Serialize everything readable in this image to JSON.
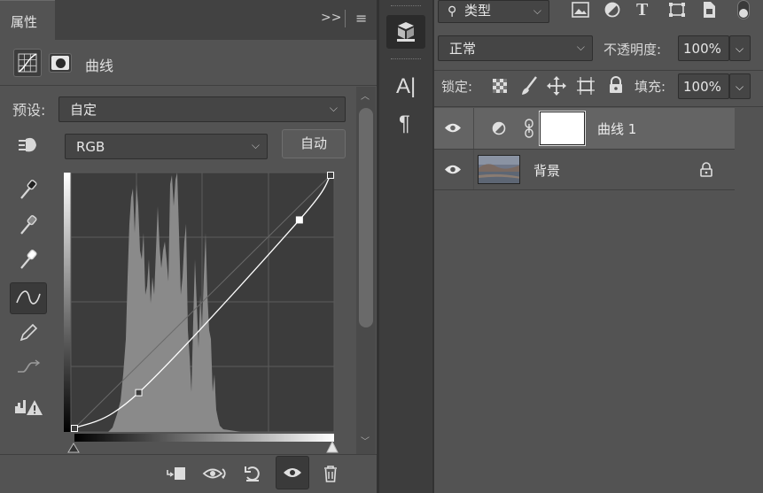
{
  "properties": {
    "tab_title": "属性",
    "header_collapse": ">>",
    "panel_title": "曲线",
    "preset_label": "预设:",
    "preset_value": "自定",
    "channel_value": "RGB",
    "auto_button": "自动"
  },
  "curve": {
    "points": [
      [
        0,
        0
      ],
      [
        64,
        36
      ],
      [
        224,
        210
      ],
      [
        255,
        255
      ]
    ]
  },
  "toolbar_mid": {
    "character_label": "A|",
    "paragraph_label": "¶"
  },
  "layers_panel": {
    "filter_type": "类型",
    "blend_mode": "正常",
    "opacity_label": "不透明度:",
    "opacity_value": "100%",
    "lock_label": "锁定:",
    "fill_label": "填充:",
    "fill_value": "100%",
    "layers": [
      {
        "name": "曲线 1",
        "type": "adjustment",
        "selected": true
      },
      {
        "name": "背景",
        "type": "image",
        "locked": true
      }
    ]
  },
  "colors": {
    "panel_bg": "#535353",
    "dark_bg": "#323232",
    "selected_layer": "#646464"
  }
}
